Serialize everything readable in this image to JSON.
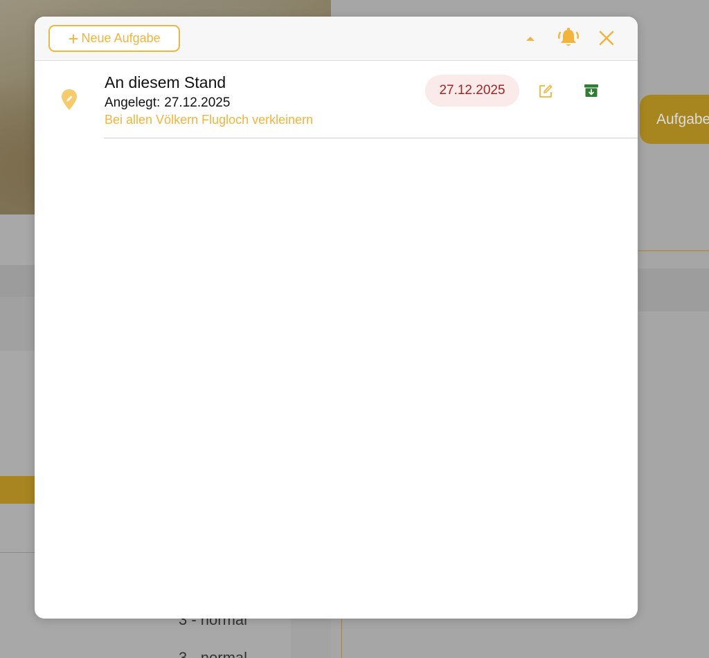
{
  "modal": {
    "new_task_label": "Neue Aufgabe",
    "icons": {
      "collapse": "caret-up-icon",
      "alarm": "bell-ringing-icon",
      "close": "close-icon"
    }
  },
  "task": {
    "title": "An diesem Stand",
    "created_label": "Angelegt:",
    "created_date": "27.12.2025",
    "note": "Bei allen Völkern Flugloch verkleinern",
    "due_date": "27.12.2025",
    "icons": {
      "location": "map-pin-icon",
      "edit": "edit-icon",
      "archive": "archive-icon"
    }
  },
  "background": {
    "aufgabe_button_label": "Aufgabe",
    "list_value": "3 - normal",
    "list_value_2": "3 - normal"
  },
  "colors": {
    "accent": "#f2b43a",
    "due_badge_bg": "#fbeaea",
    "due_badge_text": "#9f2424",
    "archive_green": "#2e7d32"
  }
}
